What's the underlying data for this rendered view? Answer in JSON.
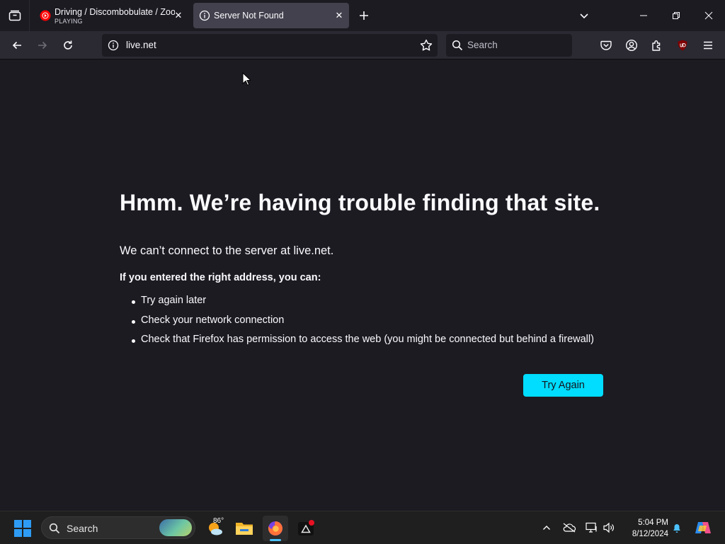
{
  "browser": {
    "tabs": [
      {
        "title": "Driving / Discombobulate / Zoo",
        "status": "PLAYING",
        "favicon": "youtube-music-icon",
        "active": false
      },
      {
        "title": "Server Not Found",
        "favicon": "info-icon",
        "active": true
      }
    ],
    "url": "live.net",
    "search_placeholder": "Search"
  },
  "error_page": {
    "title": "Hmm. We’re having trouble finding that site.",
    "short_desc": "We can’t connect to the server at live.net.",
    "lead": "If you entered the right address, you can:",
    "suggestions": [
      "Try again later",
      "Check your network connection",
      "Check that Firefox has permission to access the web (you might be connected but behind a firewall)"
    ],
    "try_again_label": "Try Again"
  },
  "taskbar": {
    "search_label": "Search",
    "weather_temp": "86°",
    "time": "5:04 PM",
    "date": "8/12/2024"
  },
  "colors": {
    "accent": "#00ddff",
    "page_bg": "#1c1b22",
    "toolbar_bg": "#2b2a33"
  }
}
